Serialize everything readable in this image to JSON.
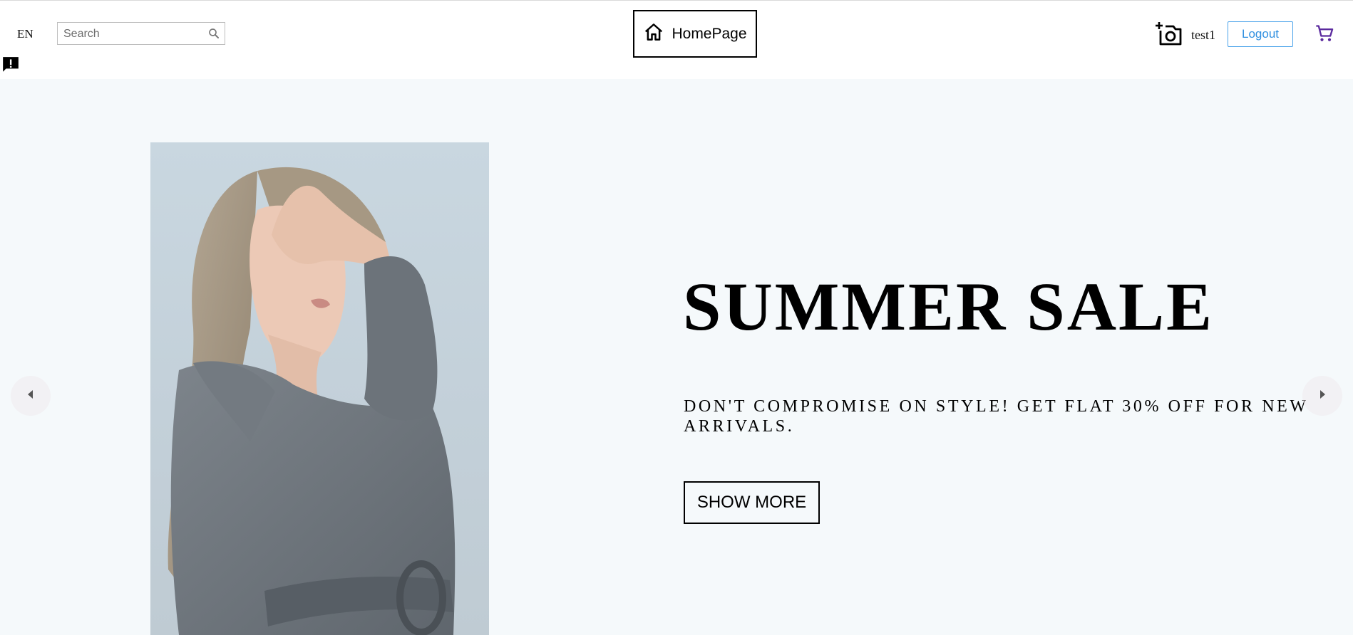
{
  "header": {
    "language": "EN",
    "search": {
      "placeholder": "Search",
      "value": ""
    },
    "home_button_label": "HomePage",
    "username": "test1",
    "logout_label": "Logout"
  },
  "hero": {
    "title": "SUMMER SALE",
    "description": "DON'T COMPROMISE ON STYLE! GET FLAT 30% OFF FOR NEW ARRIVALS.",
    "button_label": "SHOW MORE",
    "image": "woman-in-grey-coat-covering-face"
  },
  "icons": {
    "search": "search-icon",
    "home": "home-icon",
    "camera": "add-photo-icon",
    "cart": "shopping-cart-icon",
    "feedback": "feedback-icon",
    "prev": "arrow-left-icon",
    "next": "arrow-right-icon"
  },
  "colors": {
    "hero_background": "#f5f9fb",
    "logout_accent": "#2f8fe0",
    "cart_icon": "#5b2a9e"
  }
}
